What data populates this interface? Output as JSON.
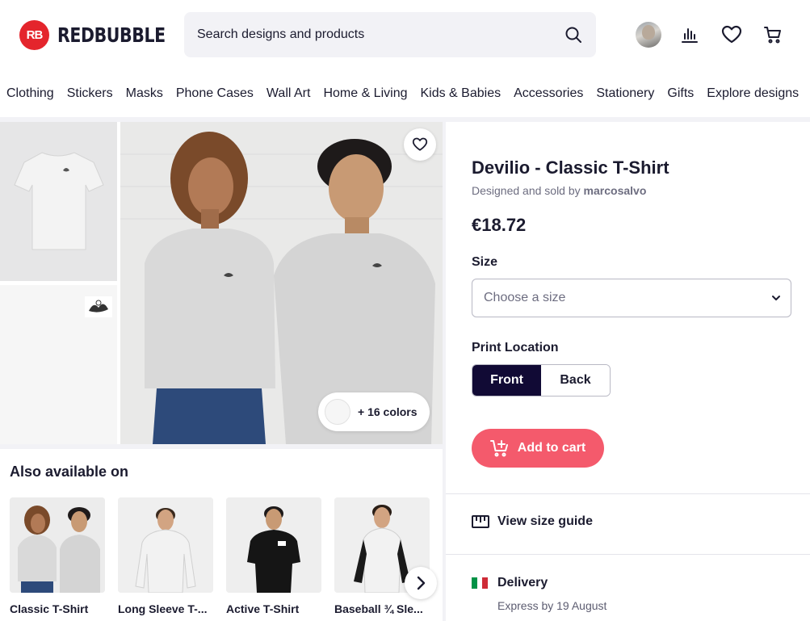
{
  "header": {
    "logo_mark": "RB",
    "logo_text": "REDBUBBLE",
    "search_placeholder": "Search designs and products",
    "icons": [
      "search-icon",
      "avatar",
      "chart-icon",
      "heart-icon",
      "cart-icon"
    ]
  },
  "nav": {
    "items": [
      "Clothing",
      "Stickers",
      "Masks",
      "Phone Cases",
      "Wall Art",
      "Home & Living",
      "Kids & Babies",
      "Accessories",
      "Stationery",
      "Gifts",
      "Explore designs"
    ]
  },
  "gallery": {
    "colors_label": "+ 16 colors"
  },
  "also_available": {
    "title": "Also available on",
    "items": [
      "Classic T-Shirt",
      "Long Sleeve T-...",
      "Active T-Shirt",
      "Baseball ¾ Sle..."
    ]
  },
  "product": {
    "title": "Devilio - Classic T-Shirt",
    "sold_prefix": "Designed and sold by ",
    "seller": "marcosalvo",
    "price": "€18.72",
    "size_label": "Size",
    "size_placeholder": "Choose a size",
    "print_location_label": "Print Location",
    "print_options": [
      "Front",
      "Back"
    ],
    "add_to_cart": "Add to cart",
    "size_guide": "View size guide",
    "delivery_label": "Delivery",
    "delivery_detail": "Express by 19 August"
  },
  "colors": {
    "brand_red": "#e4252c",
    "cart_button": "#f45a6c",
    "navy": "#110a35",
    "text": "#1b1b2f"
  }
}
